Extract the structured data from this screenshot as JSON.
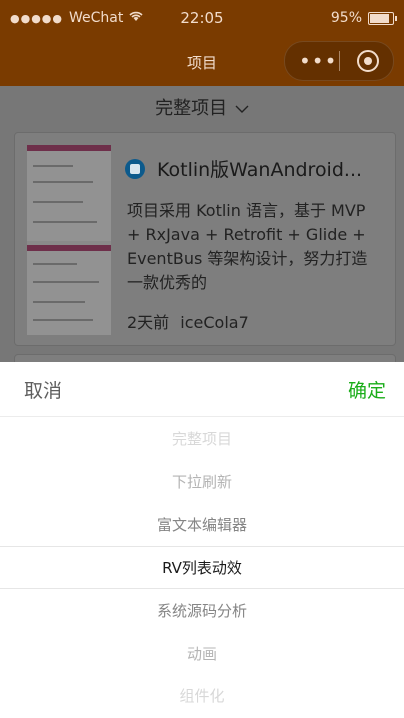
{
  "status_bar": {
    "carrier": "WeChat",
    "time": "22:05",
    "battery": "95%",
    "battery_level": 0.95
  },
  "nav": {
    "title": "项目",
    "more_icon": "more-dots-icon",
    "close_icon": "target-icon"
  },
  "filter": {
    "label": "完整项目",
    "icon": "chevron-down-icon"
  },
  "card": {
    "title": "Kotlin版WanAndroid...",
    "description": "项目采用 Kotlin 语言，基于 MVP + RxJava + Retrofit + Glide + EventBus 等架构设计，努力打造一款优秀的",
    "time": "2天前",
    "author": "iceCola7"
  },
  "picker": {
    "cancel_label": "取消",
    "confirm_label": "确定",
    "options": [
      "完整项目",
      "下拉刷新",
      "富文本编辑器",
      "RV列表动效",
      "系统源码分析",
      "动画",
      "组件化"
    ],
    "selected_index": 3,
    "confirm_color": "#1aad19"
  }
}
